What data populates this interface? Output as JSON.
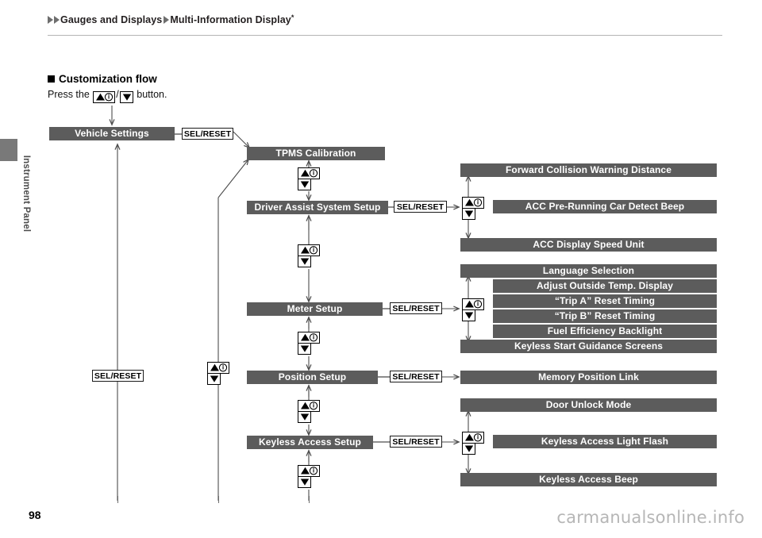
{
  "header": {
    "breadcrumb": [
      "Gauges and Displays",
      "Multi-Information Display"
    ],
    "breadcrumb_star": "*"
  },
  "sidebar": {
    "tab_label": "Instrument Panel"
  },
  "section": {
    "heading": "Customization flow",
    "instruction_before": "Press the ",
    "instruction_sep": "/",
    "instruction_after": " button."
  },
  "icons": {
    "up_info": "up-arrow-info-button-icon",
    "down": "down-arrow-button-icon",
    "bullet": "black-square-bullet-icon",
    "crumb_arrow": "triangle-right-icon"
  },
  "labels": {
    "sel_reset": "SEL/RESET"
  },
  "flow": {
    "root": "Vehicle Settings",
    "menus": [
      "TPMS Calibration",
      "Driver Assist System Setup",
      "Meter Setup",
      "Position Setup",
      "Keyless Access Setup"
    ],
    "driver_assist_items": [
      "Forward Collision Warning Distance",
      "ACC Pre-Running Car Detect Beep",
      "ACC Display Speed Unit"
    ],
    "meter_setup_items": [
      "Language Selection",
      "Adjust Outside Temp. Display",
      "“Trip A” Reset Timing",
      "“Trip B” Reset Timing",
      "Fuel Efficiency Backlight",
      "Keyless Start Guidance Screens"
    ],
    "position_setup_items": [
      "Memory Position Link"
    ],
    "keyless_access_items": [
      "Door Unlock Mode",
      "Keyless Access Light Flash",
      "Keyless Access Beep"
    ]
  },
  "footer": {
    "page_number": "98",
    "watermark": "carmanualsonline.info"
  },
  "colors": {
    "box_fill": "#5c5c5c",
    "line": "#4d4d4d",
    "tab": "#797979",
    "watermark": "#b6b6b6"
  }
}
